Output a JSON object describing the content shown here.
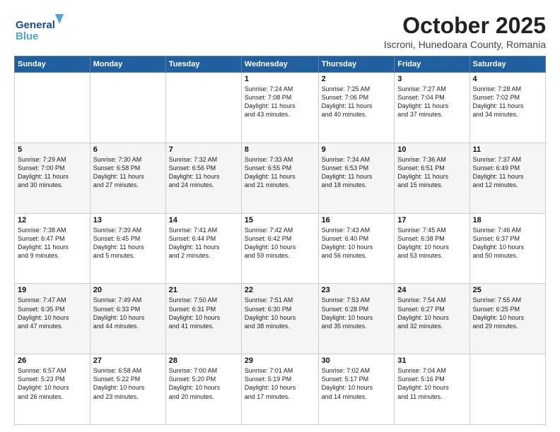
{
  "header": {
    "logo_line1": "General",
    "logo_line2": "Blue",
    "month": "October 2025",
    "location": "Iscroni, Hunedoara County, Romania"
  },
  "weekdays": [
    "Sunday",
    "Monday",
    "Tuesday",
    "Wednesday",
    "Thursday",
    "Friday",
    "Saturday"
  ],
  "weeks": [
    [
      {
        "day": "",
        "info": ""
      },
      {
        "day": "",
        "info": ""
      },
      {
        "day": "",
        "info": ""
      },
      {
        "day": "1",
        "info": "Sunrise: 7:24 AM\nSunset: 7:08 PM\nDaylight: 11 hours\nand 43 minutes."
      },
      {
        "day": "2",
        "info": "Sunrise: 7:25 AM\nSunset: 7:06 PM\nDaylight: 11 hours\nand 40 minutes."
      },
      {
        "day": "3",
        "info": "Sunrise: 7:27 AM\nSunset: 7:04 PM\nDaylight: 11 hours\nand 37 minutes."
      },
      {
        "day": "4",
        "info": "Sunrise: 7:28 AM\nSunset: 7:02 PM\nDaylight: 11 hours\nand 34 minutes."
      }
    ],
    [
      {
        "day": "5",
        "info": "Sunrise: 7:29 AM\nSunset: 7:00 PM\nDaylight: 11 hours\nand 30 minutes."
      },
      {
        "day": "6",
        "info": "Sunrise: 7:30 AM\nSunset: 6:58 PM\nDaylight: 11 hours\nand 27 minutes."
      },
      {
        "day": "7",
        "info": "Sunrise: 7:32 AM\nSunset: 6:56 PM\nDaylight: 11 hours\nand 24 minutes."
      },
      {
        "day": "8",
        "info": "Sunrise: 7:33 AM\nSunset: 6:55 PM\nDaylight: 11 hours\nand 21 minutes."
      },
      {
        "day": "9",
        "info": "Sunrise: 7:34 AM\nSunset: 6:53 PM\nDaylight: 11 hours\nand 18 minutes."
      },
      {
        "day": "10",
        "info": "Sunrise: 7:36 AM\nSunset: 6:51 PM\nDaylight: 11 hours\nand 15 minutes."
      },
      {
        "day": "11",
        "info": "Sunrise: 7:37 AM\nSunset: 6:49 PM\nDaylight: 11 hours\nand 12 minutes."
      }
    ],
    [
      {
        "day": "12",
        "info": "Sunrise: 7:38 AM\nSunset: 6:47 PM\nDaylight: 11 hours\nand 9 minutes."
      },
      {
        "day": "13",
        "info": "Sunrise: 7:39 AM\nSunset: 6:45 PM\nDaylight: 11 hours\nand 5 minutes."
      },
      {
        "day": "14",
        "info": "Sunrise: 7:41 AM\nSunset: 6:44 PM\nDaylight: 11 hours\nand 2 minutes."
      },
      {
        "day": "15",
        "info": "Sunrise: 7:42 AM\nSunset: 6:42 PM\nDaylight: 10 hours\nand 59 minutes."
      },
      {
        "day": "16",
        "info": "Sunrise: 7:43 AM\nSunset: 6:40 PM\nDaylight: 10 hours\nand 56 minutes."
      },
      {
        "day": "17",
        "info": "Sunrise: 7:45 AM\nSunset: 6:38 PM\nDaylight: 10 hours\nand 53 minutes."
      },
      {
        "day": "18",
        "info": "Sunrise: 7:46 AM\nSunset: 6:37 PM\nDaylight: 10 hours\nand 50 minutes."
      }
    ],
    [
      {
        "day": "19",
        "info": "Sunrise: 7:47 AM\nSunset: 6:35 PM\nDaylight: 10 hours\nand 47 minutes."
      },
      {
        "day": "20",
        "info": "Sunrise: 7:49 AM\nSunset: 6:33 PM\nDaylight: 10 hours\nand 44 minutes."
      },
      {
        "day": "21",
        "info": "Sunrise: 7:50 AM\nSunset: 6:31 PM\nDaylight: 10 hours\nand 41 minutes."
      },
      {
        "day": "22",
        "info": "Sunrise: 7:51 AM\nSunset: 6:30 PM\nDaylight: 10 hours\nand 38 minutes."
      },
      {
        "day": "23",
        "info": "Sunrise: 7:53 AM\nSunset: 6:28 PM\nDaylight: 10 hours\nand 35 minutes."
      },
      {
        "day": "24",
        "info": "Sunrise: 7:54 AM\nSunset: 6:27 PM\nDaylight: 10 hours\nand 32 minutes."
      },
      {
        "day": "25",
        "info": "Sunrise: 7:55 AM\nSunset: 6:25 PM\nDaylight: 10 hours\nand 29 minutes."
      }
    ],
    [
      {
        "day": "26",
        "info": "Sunrise: 6:57 AM\nSunset: 5:23 PM\nDaylight: 10 hours\nand 26 minutes."
      },
      {
        "day": "27",
        "info": "Sunrise: 6:58 AM\nSunset: 5:22 PM\nDaylight: 10 hours\nand 23 minutes."
      },
      {
        "day": "28",
        "info": "Sunrise: 7:00 AM\nSunset: 5:20 PM\nDaylight: 10 hours\nand 20 minutes."
      },
      {
        "day": "29",
        "info": "Sunrise: 7:01 AM\nSunset: 5:19 PM\nDaylight: 10 hours\nand 17 minutes."
      },
      {
        "day": "30",
        "info": "Sunrise: 7:02 AM\nSunset: 5:17 PM\nDaylight: 10 hours\nand 14 minutes."
      },
      {
        "day": "31",
        "info": "Sunrise: 7:04 AM\nSunset: 5:16 PM\nDaylight: 10 hours\nand 11 minutes."
      },
      {
        "day": "",
        "info": ""
      }
    ]
  ]
}
